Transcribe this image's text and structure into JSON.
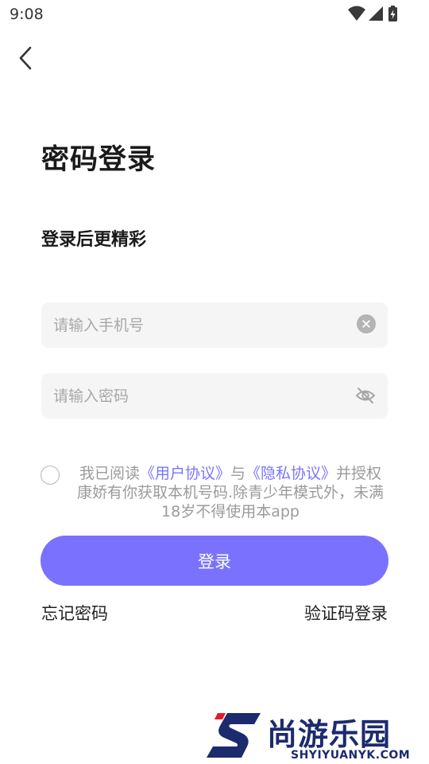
{
  "status_bar": {
    "time": "9:08",
    "icons": [
      "wifi-icon",
      "cellular-signal-icon",
      "battery-charging-icon"
    ]
  },
  "nav": {
    "back_icon": "chevron-left-icon"
  },
  "header": {
    "title": "密码登录",
    "subtitle": "登录后更精彩"
  },
  "form": {
    "phone_placeholder": "请输入手机号",
    "phone_value": "",
    "password_placeholder": "请输入密码",
    "password_value": "",
    "clear_icon": "clear-circle-icon",
    "visibility_icon": "eye-off-icon"
  },
  "agreement": {
    "checked": false,
    "prefix": "我已阅读",
    "user_agreement": "《用户协议》",
    "conjunction": "与",
    "privacy_policy": "《隐私协议》",
    "suffix": "并授权康娇有你获取本机号码.除青少年模式外，未满18岁不得使用本app"
  },
  "buttons": {
    "login": "登录",
    "forgot_password": "忘记密码",
    "code_login": "验证码登录"
  },
  "watermark": {
    "name": "尚游乐园",
    "url": "SHYIYUANYK.COM"
  },
  "colors": {
    "accent": "#7a72ff",
    "link": "#7b74ff",
    "input_bg": "#f5f5f5",
    "watermark_navy": "#1c2a6e",
    "watermark_red": "#e21b2b"
  }
}
